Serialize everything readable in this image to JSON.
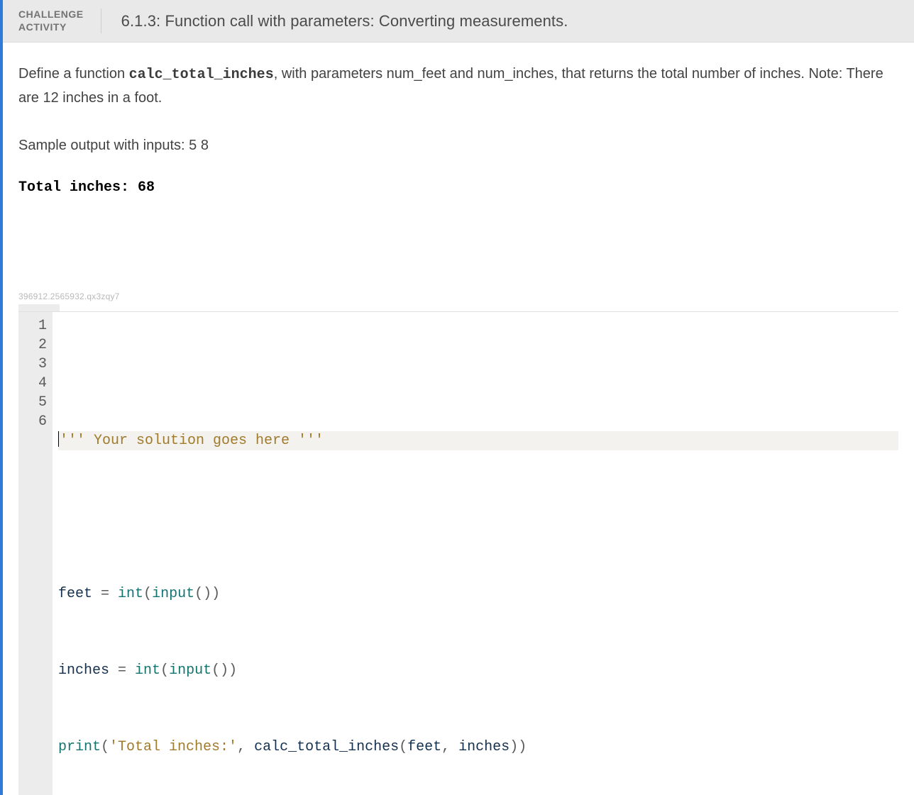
{
  "header": {
    "label_line1": "CHALLENGE",
    "label_line2": "ACTIVITY",
    "title": "6.1.3: Function call with parameters: Converting measurements."
  },
  "prompt": {
    "pre": "Define a function ",
    "code": "calc_total_inches",
    "post": ", with parameters num_feet and num_inches, that returns the total number of inches. Note: There are 12 inches in a foot.",
    "sample_label": "Sample output with inputs: 5 8",
    "sample_output": "Total inches: 68"
  },
  "watermark": "396912.2565932.qx3zqy7",
  "editor": {
    "line_numbers": [
      "1",
      "2",
      "3",
      "4",
      "5",
      "6"
    ],
    "lines": {
      "l1": "",
      "l2_str": "''' Your solution goes here '''",
      "l3": "",
      "l4_ident1": "feet",
      "l4_op1": " = ",
      "l4_builtin1": "int",
      "l4_p1": "(",
      "l4_builtin2": "input",
      "l4_p2": "())",
      "l5_ident1": "inches",
      "l5_op1": " = ",
      "l5_builtin1": "int",
      "l5_p1": "(",
      "l5_builtin2": "input",
      "l5_p2": "())",
      "l6_builtin1": "print",
      "l6_p1": "(",
      "l6_str": "'Total inches:'",
      "l6_comma": ", ",
      "l6_ident1": "calc_total_inches",
      "l6_p2": "(",
      "l6_ident2": "feet",
      "l6_comma2": ", ",
      "l6_ident3": "inches",
      "l6_p3": "))"
    }
  }
}
